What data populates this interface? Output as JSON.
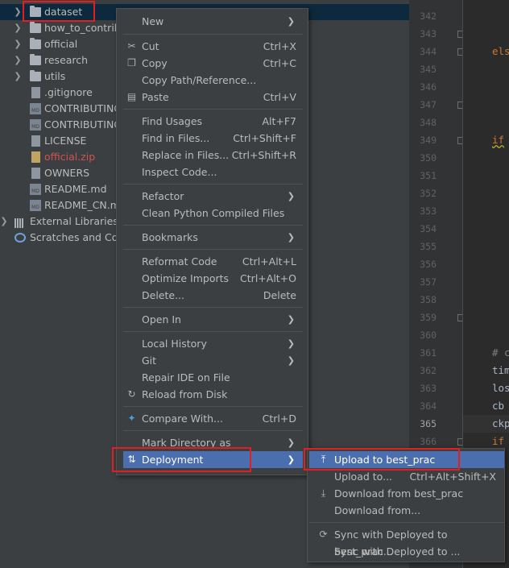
{
  "tree": {
    "items": [
      {
        "label": "dataset",
        "type": "folder"
      },
      {
        "label": "how_to_contrib",
        "type": "folder"
      },
      {
        "label": "official",
        "type": "folder"
      },
      {
        "label": "research",
        "type": "folder"
      },
      {
        "label": "utils",
        "type": "folder"
      },
      {
        "label": ".gitignore",
        "type": "file"
      },
      {
        "label": "CONTRIBUTING",
        "type": "md"
      },
      {
        "label": "CONTRIBUTING",
        "type": "md"
      },
      {
        "label": "LICENSE",
        "type": "file"
      },
      {
        "label": "official.zip",
        "type": "zip"
      },
      {
        "label": "OWNERS",
        "type": "file"
      },
      {
        "label": "README.md",
        "type": "md"
      },
      {
        "label": "README_CN.m",
        "type": "md"
      },
      {
        "label": "External Libraries",
        "type": "lib"
      },
      {
        "label": "Scratches and Cor",
        "type": "scratch"
      }
    ]
  },
  "gutter": {
    "lines": [
      "342",
      "343",
      "344",
      "345",
      "346",
      "347",
      "348",
      "349",
      "350",
      "351",
      "352",
      "353",
      "354",
      "355",
      "356",
      "357",
      "358",
      "359",
      "360",
      "361",
      "362",
      "363",
      "364",
      "365",
      "366"
    ],
    "current": "365",
    "code": {
      "l344": "els",
      "l349": "if",
      "l361": "# c",
      "l362": "tim",
      "l363": "los",
      "l364": "cb",
      "l365": "ckp",
      "l366": "if"
    }
  },
  "menu": {
    "new": "New",
    "cut": "Cut",
    "cut_sc": "Ctrl+X",
    "copy": "Copy",
    "copy_sc": "Ctrl+C",
    "copy_path": "Copy Path/Reference...",
    "paste": "Paste",
    "paste_sc": "Ctrl+V",
    "find_usages": "Find Usages",
    "find_usages_sc": "Alt+F7",
    "find_in_files": "Find in Files...",
    "find_in_files_sc": "Ctrl+Shift+F",
    "replace_in_files": "Replace in Files...",
    "replace_in_files_sc": "Ctrl+Shift+R",
    "inspect_code": "Inspect Code...",
    "refactor": "Refactor",
    "clean_python": "Clean Python Compiled Files",
    "bookmarks": "Bookmarks",
    "reformat": "Reformat Code",
    "reformat_sc": "Ctrl+Alt+L",
    "optimize": "Optimize Imports",
    "optimize_sc": "Ctrl+Alt+O",
    "delete": "Delete...",
    "delete_sc": "Delete",
    "open_in": "Open In",
    "local_history": "Local History",
    "git": "Git",
    "repair_ide": "Repair IDE on File",
    "reload": "Reload from Disk",
    "compare": "Compare With...",
    "compare_sc": "Ctrl+D",
    "mark_dir": "Mark Directory as",
    "deployment": "Deployment"
  },
  "submenu": {
    "upload_best": "Upload to best_prac",
    "upload_to": "Upload to...",
    "upload_to_sc": "Ctrl+Alt+Shift+X",
    "download_best": "Download from best_prac",
    "download_from": "Download from...",
    "sync_best": "Sync with Deployed to best_prac...",
    "sync_to": "Sync with Deployed to ..."
  },
  "colors": {
    "highlight": "#4b6eaf",
    "annotation": "#e02020",
    "menu_bg": "#3c3f41"
  }
}
